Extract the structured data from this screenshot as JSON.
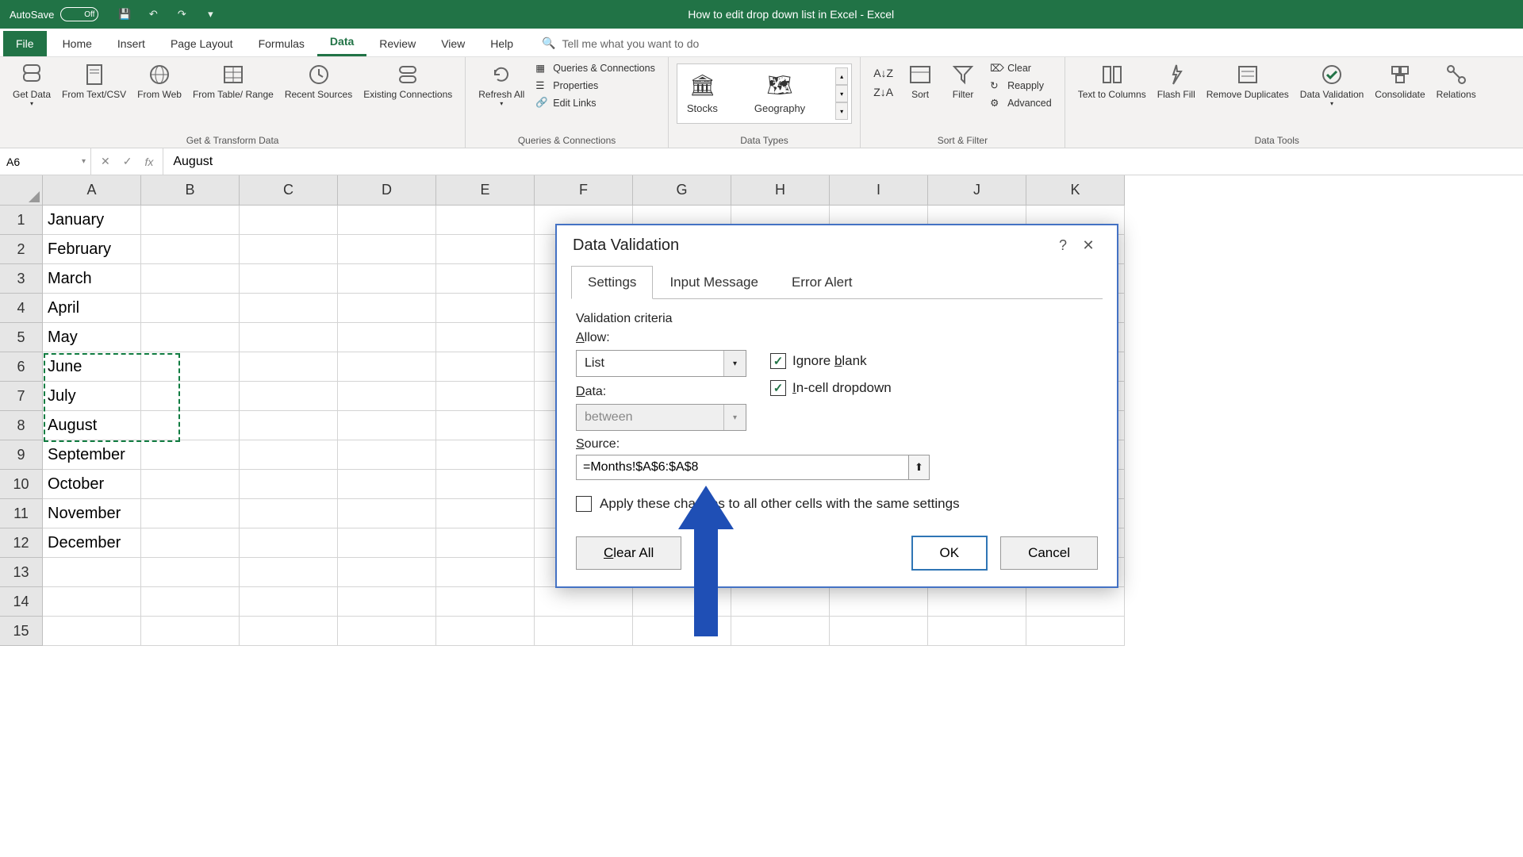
{
  "titlebar": {
    "autosave_label": "AutoSave",
    "autosave_state": "Off",
    "document_title": "How to edit drop down list in Excel  -  Excel"
  },
  "ribbon_tabs": [
    "File",
    "Home",
    "Insert",
    "Page Layout",
    "Formulas",
    "Data",
    "Review",
    "View",
    "Help"
  ],
  "active_tab": "Data",
  "tellme_placeholder": "Tell me what you want to do",
  "ribbon": {
    "groups": {
      "get_transform": {
        "label": "Get & Transform Data",
        "items": [
          "Get Data",
          "From Text/CSV",
          "From Web",
          "From Table/ Range",
          "Recent Sources",
          "Existing Connections"
        ]
      },
      "queries": {
        "label": "Queries & Connections",
        "refresh": "Refresh All",
        "items": [
          "Queries & Connections",
          "Properties",
          "Edit Links"
        ]
      },
      "datatypes": {
        "label": "Data Types",
        "items": [
          "Stocks",
          "Geography"
        ]
      },
      "sortfilter": {
        "label": "Sort & Filter",
        "sort": "Sort",
        "filter": "Filter",
        "items": [
          "Clear",
          "Reapply",
          "Advanced"
        ]
      },
      "datatools": {
        "label": "Data Tools",
        "items": [
          "Text to Columns",
          "Flash Fill",
          "Remove Duplicates",
          "Data Validation",
          "Consolidate",
          "Relations"
        ]
      }
    }
  },
  "namebox": "A6",
  "formula_value": "August",
  "columns": [
    "A",
    "B",
    "C",
    "D",
    "E",
    "F",
    "G",
    "H",
    "I",
    "J",
    "K"
  ],
  "rows": [
    {
      "n": "1",
      "A": "January"
    },
    {
      "n": "2",
      "A": "February"
    },
    {
      "n": "3",
      "A": "March"
    },
    {
      "n": "4",
      "A": "April"
    },
    {
      "n": "5",
      "A": "May"
    },
    {
      "n": "6",
      "A": "June"
    },
    {
      "n": "7",
      "A": "July"
    },
    {
      "n": "8",
      "A": "August"
    },
    {
      "n": "9",
      "A": "September"
    },
    {
      "n": "10",
      "A": "October"
    },
    {
      "n": "11",
      "A": "November"
    },
    {
      "n": "12",
      "A": "December"
    },
    {
      "n": "13",
      "A": ""
    },
    {
      "n": "14",
      "A": ""
    },
    {
      "n": "15",
      "A": ""
    }
  ],
  "dialog": {
    "title": "Data Validation",
    "tabs": [
      "Settings",
      "Input Message",
      "Error Alert"
    ],
    "active_tab": "Settings",
    "criteria_label": "Validation criteria",
    "allow_label": "Allow:",
    "allow_value": "List",
    "data_label": "Data:",
    "data_value": "between",
    "ignore_blank": "Ignore blank",
    "incell_dropdown": "In-cell dropdown",
    "source_label": "Source:",
    "source_value": "=Months!$A$6:$A$8",
    "apply_label": "Apply these changes to all other cells with the same settings",
    "clear_all": "Clear All",
    "ok": "OK",
    "cancel": "Cancel"
  }
}
